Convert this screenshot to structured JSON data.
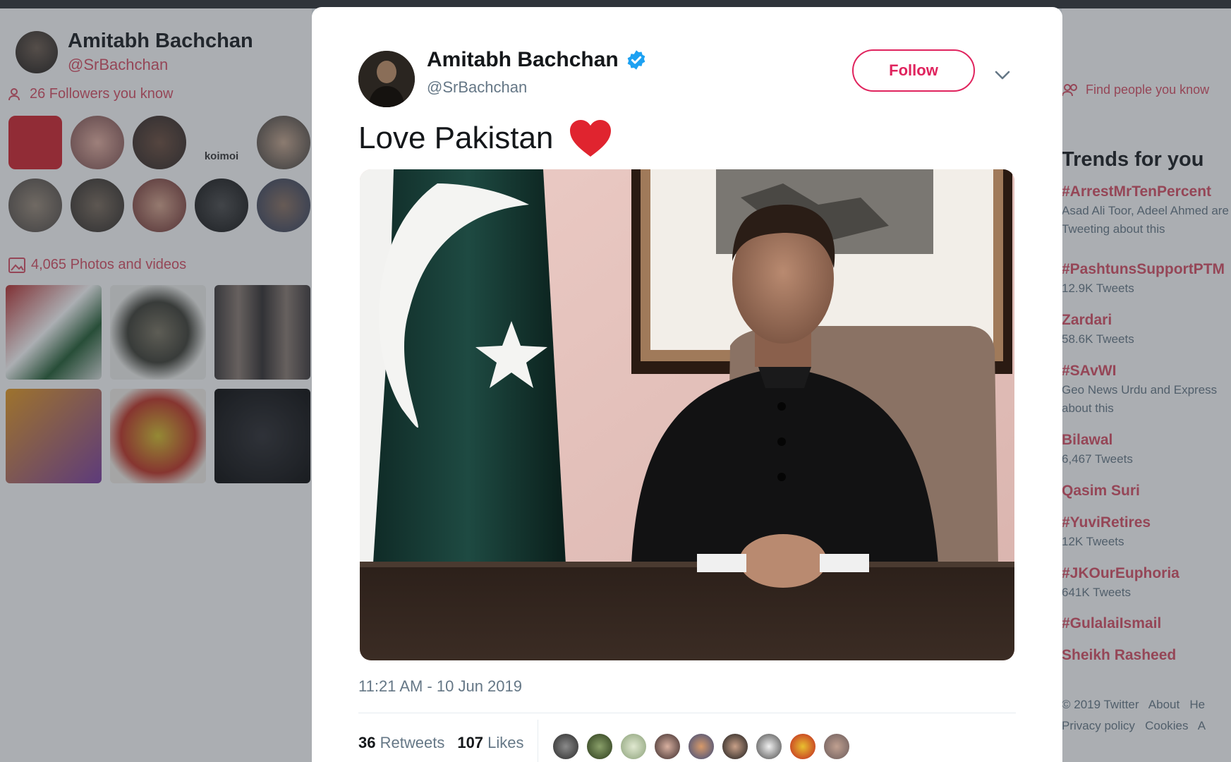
{
  "background": {
    "profile_name": "Amitabh Bachchan",
    "profile_handle": "@SrBachchan",
    "followers_you_know": "26 Followers you know",
    "photos_videos": "4,065 Photos and videos",
    "koimoi_label": "koimoi",
    "find_people": "Find people you know",
    "trends_title": "Trends for you",
    "trends": [
      {
        "name": "#ArrestMrTenPercent",
        "sub": "Asad Ali Toor, Adeel Ahmed are Tweeting about this"
      },
      {
        "name": "#PashtunsSupportPTM",
        "sub": "12.9K Tweets"
      },
      {
        "name": "Zardari",
        "sub": "58.6K Tweets"
      },
      {
        "name": "#SAvWI",
        "sub": "Geo News Urdu and Express about this"
      },
      {
        "name": "Bilawal",
        "sub": "6,467 Tweets"
      },
      {
        "name": "Qasim Suri",
        "sub": ""
      },
      {
        "name": "#YuviRetires",
        "sub": "12K Tweets"
      },
      {
        "name": "#JKOurEuphoria",
        "sub": "641K Tweets"
      },
      {
        "name": "#GulalaiIsmail",
        "sub": ""
      },
      {
        "name": "Sheikh Rasheed",
        "sub": ""
      }
    ],
    "footer_line1": "© 2019 Twitter   About   He",
    "footer_line2": "Privacy policy   Cookies   A"
  },
  "tweet": {
    "author_name": "Amitabh Bachchan",
    "author_handle": "@SrBachchan",
    "follow_label": "Follow",
    "text": "Love Pakistan",
    "timestamp": "11:21 AM - 10 Jun 2019",
    "retweets_count": "36",
    "retweets_label": "Retweets",
    "likes_count": "107",
    "likes_label": "Likes"
  },
  "colors": {
    "accent": "#e0245e",
    "verified": "#1da1f2",
    "muted": "#657786"
  },
  "icons": [
    "verified-badge-icon",
    "chevron-down-icon",
    "red-heart-icon",
    "people-icon",
    "photo-icon"
  ]
}
